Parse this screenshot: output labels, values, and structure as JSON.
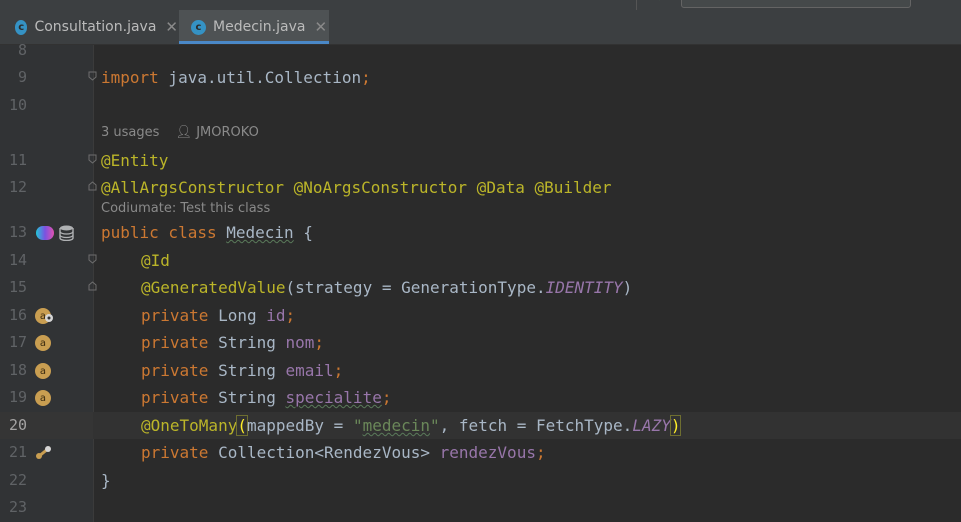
{
  "tabs": [
    {
      "label": "Consultation.java",
      "icon": "java-class-icon",
      "active": false
    },
    {
      "label": "Medecin.java",
      "icon": "java-class-icon",
      "active": true
    }
  ],
  "tab_close_glyph": "✕",
  "class_icon_letter": "c",
  "hints": {
    "usages": "3 usages",
    "author": "JMOROKO",
    "codiumate": "Codiumate: Test this class"
  },
  "lines": {
    "l8": "8",
    "l9": "9",
    "l10": "10",
    "l11": "11",
    "l12": "12",
    "l13": "13",
    "l14": "14",
    "l15": "15",
    "l16": "16",
    "l17": "17",
    "l18": "18",
    "l19": "19",
    "l20": "20",
    "l21": "21",
    "l22": "22",
    "l23": "23"
  },
  "code": {
    "import_kw": "import",
    "import_path": " java.util.Collection",
    "semi": ";",
    "entity": "@Entity",
    "lombok": "@AllArgsConstructor @NoArgsConstructor @Data @Builder",
    "public_class": "public class ",
    "class_name": "Medecin",
    "open_brace": " {",
    "id_ann": "@Id",
    "genval_ann": "@GeneratedValue",
    "genval_args": "(strategy = GenerationType.",
    "identity": "IDENTITY",
    "close_paren": ")",
    "private": "private ",
    "t_long": "Long ",
    "f_id": "id",
    "t_string": "String ",
    "f_nom": "nom",
    "f_email": "email",
    "f_specialite": "specialite",
    "otm_ann": "@OneToMany",
    "paren_open": "(",
    "mapped_by": "mappedBy = ",
    "q": "\"",
    "medecin_str": "medecin",
    "fetch": ", fetch = FetchType.",
    "lazy": "LAZY",
    "paren_close": ")",
    "t_collection": "Collection<RendezVous> ",
    "f_rendezvous": "rendezVous",
    "close_brace": "}"
  },
  "gutter_icons": {
    "line13": [
      "spring-bean-icon",
      "database-icon"
    ],
    "line16": "lombok-annotation-icon",
    "line17": "lombok-annotation-icon",
    "line18": "lombok-annotation-icon",
    "line19": "lombok-annotation-icon",
    "line21": "relationship-link-icon",
    "annotation_letter": "a"
  },
  "colors": {
    "background": "#2b2b2b",
    "keyword": "#cc7832",
    "annotation": "#bbb529",
    "field": "#9876aa",
    "string": "#6a8759",
    "text": "#a9b7c6",
    "tab_accent": "#4a88c7"
  }
}
